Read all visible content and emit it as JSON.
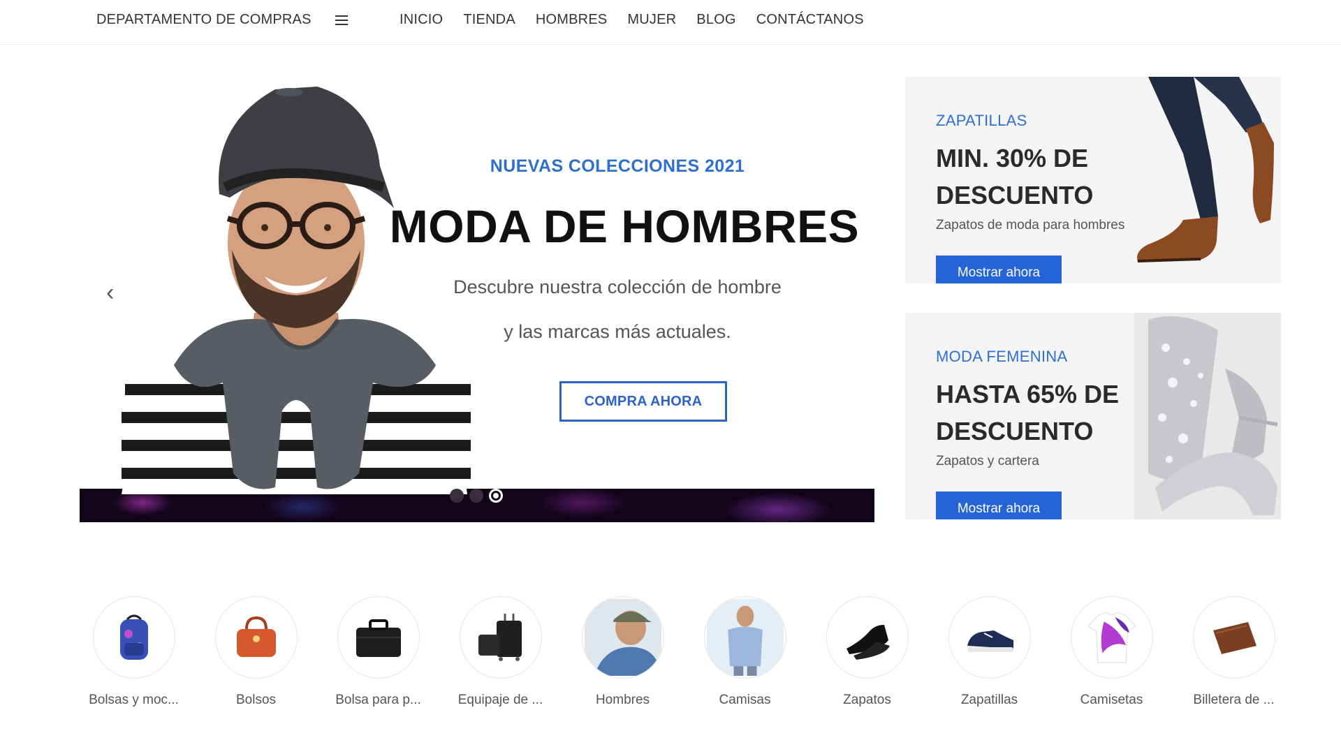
{
  "header": {
    "department_label": "DEPARTAMENTO DE COMPRAS",
    "nav": [
      "INICIO",
      "TIENDA",
      "HOMBRES",
      "MUJER",
      "BLOG",
      "CONTÁCTANOS"
    ]
  },
  "hero": {
    "eyebrow": "NUEVAS COLECCIONES 2021",
    "title": "MODA DE HOMBRES",
    "subtitle_line1": "Descubre nuestra colección de hombre",
    "subtitle_line2": "y las marcas más actuales.",
    "cta": "COMPRA AHORA",
    "prev_arrow": "‹",
    "slide_count": 3,
    "active_slide": 3
  },
  "promos": [
    {
      "eyebrow": "ZAPATILLAS",
      "title": "MIN. 30% DE DESCUENTO",
      "description": "Zapatos de moda para hombres",
      "button": "Mostrar ahora"
    },
    {
      "eyebrow": "MODA FEMENINA",
      "title": "HASTA 65% DE DESCUENTO",
      "description": "Zapatos y cartera",
      "button": "Mostrar ahora"
    }
  ],
  "categories": [
    {
      "label": "Bolsas y moc...",
      "icon": "backpack-icon"
    },
    {
      "label": "Bolsos",
      "icon": "handbag-icon"
    },
    {
      "label": "Bolsa para p...",
      "icon": "laptop-bag-icon"
    },
    {
      "label": "Equipaje de ...",
      "icon": "luggage-icon"
    },
    {
      "label": "Hombres",
      "icon": "man-cap-icon"
    },
    {
      "label": "Camisas",
      "icon": "shirt-man-icon"
    },
    {
      "label": "Zapatos",
      "icon": "dress-shoe-icon"
    },
    {
      "label": "Zapatillas",
      "icon": "sneaker-icon"
    },
    {
      "label": "Camisetas",
      "icon": "tshirt-icon"
    },
    {
      "label": "Billetera de ...",
      "icon": "wallet-icon"
    }
  ],
  "colors": {
    "accent_blue": "#2e6fd0",
    "button_blue": "#2563d8",
    "text_dark": "#222222"
  }
}
